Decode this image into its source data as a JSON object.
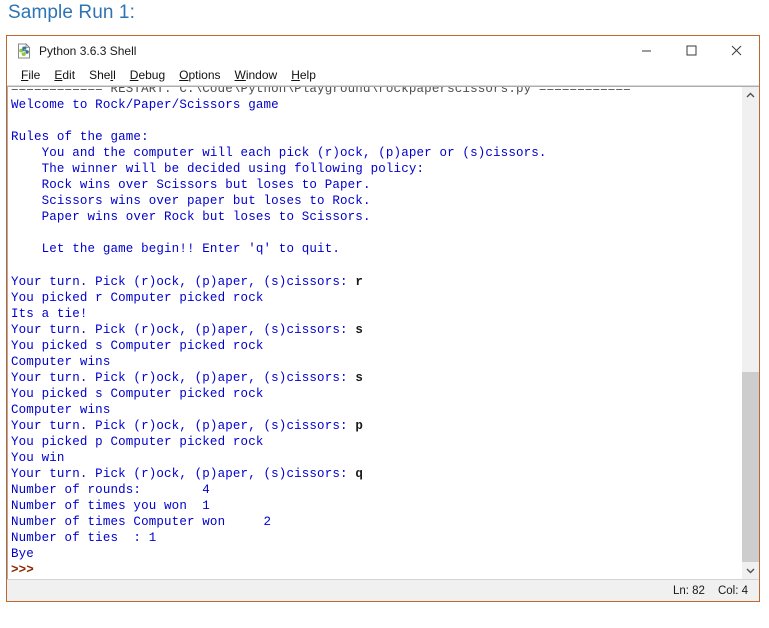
{
  "document": {
    "heading": "Sample Run 1:"
  },
  "window": {
    "title": "Python 3.6.3 Shell",
    "icon": "python-idle-icon",
    "controls": {
      "minimize": "minimize-icon",
      "maximize": "maximize-icon",
      "close": "close-icon"
    }
  },
  "menubar": {
    "items": [
      {
        "label": "File",
        "accel": "F"
      },
      {
        "label": "Edit",
        "accel": "E"
      },
      {
        "label": "Shell",
        "accel": "l"
      },
      {
        "label": "Debug",
        "accel": "D"
      },
      {
        "label": "Options",
        "accel": "O"
      },
      {
        "label": "Window",
        "accel": "W"
      },
      {
        "label": "Help",
        "accel": "H"
      }
    ]
  },
  "shell": {
    "restart_line": "============ RESTART: C:\\Code\\Python\\Playground\\rockpaperscissors.py ============",
    "lines": [
      {
        "text": "Welcome to Rock/Paper/Scissors game",
        "style": "blue"
      },
      {
        "text": "",
        "style": "blue"
      },
      {
        "text": "Rules of the game:",
        "style": "blue"
      },
      {
        "text": "    You and the computer will each pick (r)ock, (p)aper or (s)cissors.",
        "style": "blue"
      },
      {
        "text": "    The winner will be decided using following policy:",
        "style": "blue"
      },
      {
        "text": "    Rock wins over Scissors but loses to Paper.",
        "style": "blue"
      },
      {
        "text": "    Scissors wins over paper but loses to Rock.",
        "style": "blue"
      },
      {
        "text": "    Paper wins over Rock but loses to Scissors.",
        "style": "blue"
      },
      {
        "text": "",
        "style": "blue"
      },
      {
        "text": "    Let the game begin!! Enter 'q' to quit.",
        "style": "blue"
      },
      {
        "text": "",
        "style": "blue"
      },
      {
        "prompt": "Your turn. Pick (r)ock, (p)aper, (s)cissors: ",
        "input": "r"
      },
      {
        "text": "You picked r Computer picked rock",
        "style": "blue"
      },
      {
        "text": "Its a tie!",
        "style": "blue"
      },
      {
        "prompt": "Your turn. Pick (r)ock, (p)aper, (s)cissors: ",
        "input": "s"
      },
      {
        "text": "You picked s Computer picked rock",
        "style": "blue"
      },
      {
        "text": "Computer wins",
        "style": "blue"
      },
      {
        "prompt": "Your turn. Pick (r)ock, (p)aper, (s)cissors: ",
        "input": "s"
      },
      {
        "text": "You picked s Computer picked rock",
        "style": "blue"
      },
      {
        "text": "Computer wins",
        "style": "blue"
      },
      {
        "prompt": "Your turn. Pick (r)ock, (p)aper, (s)cissors: ",
        "input": "p"
      },
      {
        "text": "You picked p Computer picked rock",
        "style": "blue"
      },
      {
        "text": "You win",
        "style": "blue"
      },
      {
        "prompt": "Your turn. Pick (r)ock, (p)aper, (s)cissors: ",
        "input": "q"
      },
      {
        "text": "Number of rounds:        4",
        "style": "blue"
      },
      {
        "text": "Number of times you won  1",
        "style": "blue"
      },
      {
        "text": "Number of times Computer won     2",
        "style": "blue"
      },
      {
        "text": "Number of ties  : 1",
        "style": "blue"
      },
      {
        "text": "Bye",
        "style": "blue"
      },
      {
        "text": ">>>",
        "style": "prompt"
      }
    ]
  },
  "statusbar": {
    "line_label": "Ln: 82",
    "col_label": "Col: 4"
  },
  "scrollbar": {
    "up_arrow": "chevron-up-icon",
    "down_arrow": "chevron-down-icon",
    "thumb_top_percent": 58.5
  },
  "colors": {
    "window_border": "#C1672B",
    "shell_text": "#0000CD",
    "user_input": "#1A1A1A",
    "prompt": "#8B2500",
    "heading": "#2E74B5"
  }
}
